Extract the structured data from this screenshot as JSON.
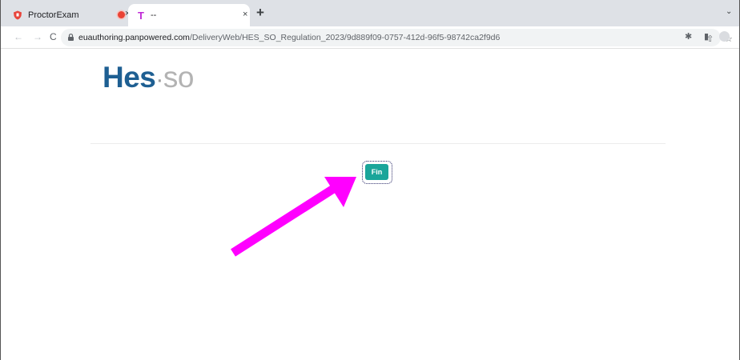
{
  "tabs": [
    {
      "title": "ProctorExam",
      "favicon": "shield-icon",
      "active": false,
      "recording": true
    },
    {
      "title": "--",
      "favicon": "T",
      "active": true
    }
  ],
  "tab_close_glyph": "×",
  "new_tab_glyph": "+",
  "tab_menu_glyph": "⌄",
  "toolbar": {
    "url_host": "euauthoring.panpowered.com",
    "url_path": "/DeliveryWeb/HES_SO_Regulation_2023/9d889f09-0757-412d-96f5-98742ca2f9d6"
  },
  "logo": {
    "part1": "Hes",
    "dot": "·",
    "part2": "so"
  },
  "fin_button": {
    "label": "Fin",
    "color": "#1aa59a"
  },
  "annotation": {
    "arrow_color": "#ff00ff"
  }
}
